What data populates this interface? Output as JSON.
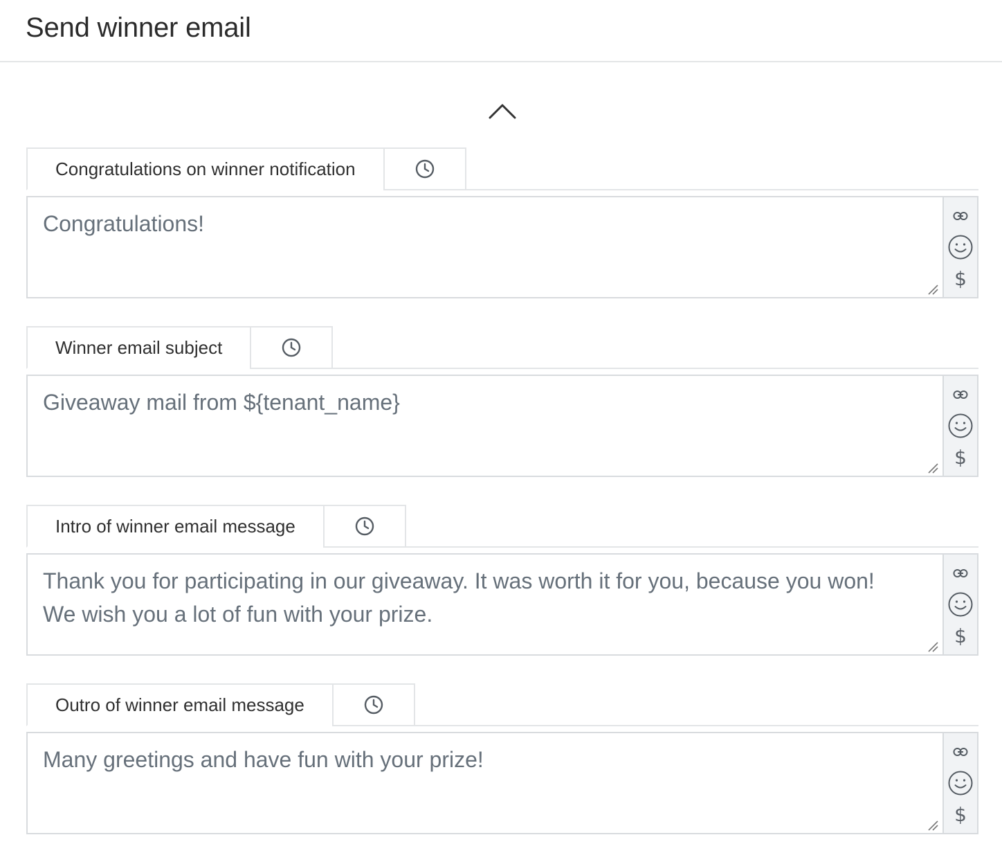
{
  "page": {
    "title": "Send winner email"
  },
  "sections": [
    {
      "tab_label": "Congratulations on winner notification",
      "value": "Congratulations!"
    },
    {
      "tab_label": "Winner email subject",
      "value": "Giveaway mail from ${tenant_name}"
    },
    {
      "tab_label": "Intro of winner email message",
      "value": "Thank you for participating in our giveaway. It was worth it for you, because you won!\nWe wish you a lot of fun with your prize."
    },
    {
      "tab_label": "Outro of winner email message",
      "value": "Many greetings and have fun with your prize!"
    }
  ],
  "toolbar": {
    "link_icon": "link-icon",
    "emoji_icon": "smiley-icon",
    "variable_symbol": "$"
  },
  "icons": {
    "collapse": "chevron-up-icon",
    "history": "clock-icon"
  },
  "colors": {
    "border": "#d8dbde",
    "toolbar_bg": "#f1f3f5",
    "field_text": "#66707a"
  }
}
